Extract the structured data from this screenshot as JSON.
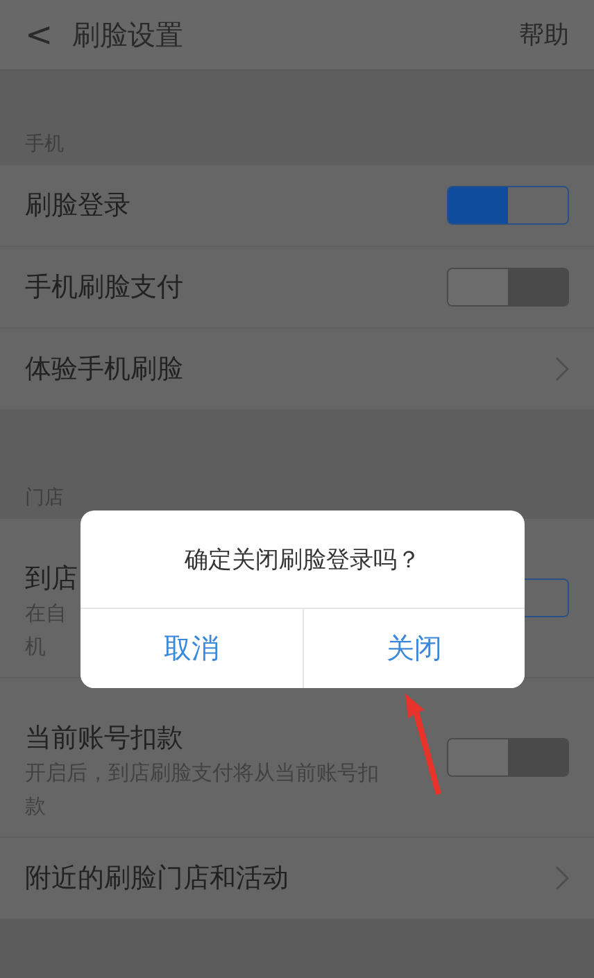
{
  "header": {
    "back_icon": "<",
    "title": "刷脸设置",
    "action": "帮助"
  },
  "sections": [
    {
      "label": "手机",
      "rows": [
        {
          "kind": "toggle",
          "title": "刷脸登录",
          "on": true
        },
        {
          "kind": "toggle",
          "title": "手机刷脸支付",
          "on": false
        },
        {
          "kind": "link",
          "title": "体验手机刷脸"
        }
      ]
    },
    {
      "label": "门店",
      "rows": [
        {
          "kind": "toggle",
          "title": "到店",
          "description_lines": [
            "在自",
            "机"
          ],
          "on": true
        },
        {
          "kind": "toggle",
          "title": "当前账号扣款",
          "description_lines": [
            "开启后，到店刷脸支付将从当前账号扣",
            "款"
          ],
          "on": false
        },
        {
          "kind": "link",
          "title": "附近的刷脸门店和活动"
        }
      ]
    }
  ],
  "dialog": {
    "message": "确定关闭刷脸登录吗？",
    "buttons": [
      "取消",
      "关闭"
    ]
  }
}
